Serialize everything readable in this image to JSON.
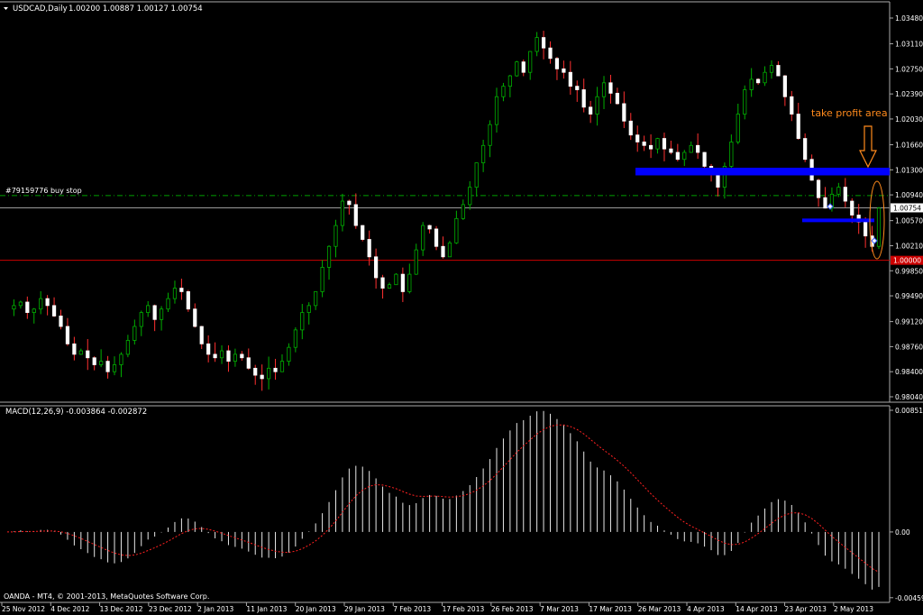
{
  "header": {
    "symbol": "USDCAD,Daily",
    "ohlc": "1.00200 1.00887 1.00127 1.00754"
  },
  "macd_header": {
    "label": "MACD(12,26,9) -0.003864 -0.002872"
  },
  "footer": {
    "copyright": "OANDA - MT4, © 2001-2013, MetaQuotes Software Corp."
  },
  "annotations": {
    "order_label": "#79159776 buy stop",
    "take_profit": "take profit area",
    "current_price": "1.00754",
    "level_label": "1.00000"
  },
  "colors": {
    "background": "#000000",
    "bull_candle": "#00b000",
    "bear_candle": "#ffffff",
    "zone": "#0000ff",
    "annotation": "#ff8a1c",
    "support_line": "#ff0000",
    "order_line": "#00a000",
    "signal_line": "#ff0000"
  },
  "chart_data": [
    {
      "type": "candlestick",
      "title": "USDCAD,Daily",
      "ylim": [
        0.9795,
        1.0355
      ],
      "y_ticks": [
        "1.03480",
        "1.03110",
        "1.02750",
        "1.02390",
        "1.02030",
        "1.01660",
        "1.01300",
        "1.00940",
        "1.00570",
        "1.00210",
        "0.99850",
        "0.99490",
        "0.99120",
        "0.98760",
        "0.98400",
        "0.98040"
      ],
      "y_tick_values": [
        1.0348,
        1.0311,
        1.0275,
        1.0239,
        1.0203,
        1.0166,
        1.013,
        1.0094,
        1.0057,
        1.0021,
        0.9985,
        0.9949,
        0.9912,
        0.9876,
        0.984,
        0.9804
      ],
      "x_ticks": [
        "25 Nov 2012",
        "4 Dec 2012",
        "13 Dec 2012",
        "23 Dec 2012",
        "2 Jan 2013",
        "11 Jan 2013",
        "20 Jan 2013",
        "29 Jan 2013",
        "7 Feb 2013",
        "17 Feb 2013",
        "26 Feb 2013",
        "7 Mar 2013",
        "17 Mar 2013",
        "26 Mar 2013",
        "4 Apr 2013",
        "14 Apr 2013",
        "23 Apr 2013",
        "2 May 2013"
      ],
      "close_path": [
        0.993,
        0.9935,
        0.994,
        0.9925,
        0.993,
        0.9945,
        0.9935,
        0.992,
        0.9905,
        0.988,
        0.9865,
        0.987,
        0.986,
        0.985,
        0.9855,
        0.984,
        0.985,
        0.9865,
        0.9885,
        0.9905,
        0.9925,
        0.9935,
        0.9915,
        0.993,
        0.9945,
        0.996,
        0.9955,
        0.993,
        0.9905,
        0.988,
        0.9865,
        0.986,
        0.987,
        0.9855,
        0.9865,
        0.986,
        0.9845,
        0.9835,
        0.983,
        0.9845,
        0.984,
        0.9855,
        0.9875,
        0.99,
        0.9925,
        0.9935,
        0.9955,
        0.999,
        1.002,
        1.005,
        1.0085,
        1.008,
        1.005,
        1.003,
        1.0005,
        0.9975,
        0.996,
        0.9965,
        0.998,
        0.9955,
        0.998,
        1.0015,
        1.005,
        1.0045,
        1.002,
        1.0005,
        1.0025,
        1.006,
        1.008,
        1.0105,
        1.014,
        1.0165,
        1.0195,
        1.0235,
        1.025,
        1.0265,
        1.0285,
        1.027,
        1.03,
        1.032,
        1.0305,
        1.029,
        1.0275,
        1.027,
        1.025,
        1.0245,
        1.022,
        1.021,
        1.0235,
        1.0255,
        1.024,
        1.0225,
        1.02,
        1.018,
        1.017,
        1.0165,
        1.016,
        1.0175,
        1.016,
        1.0155,
        1.0145,
        1.0155,
        1.0165,
        1.0155,
        1.0135,
        1.0125,
        1.0105,
        1.0135,
        1.017,
        1.021,
        1.0245,
        1.026,
        1.0255,
        1.027,
        1.028,
        1.0265,
        1.0235,
        1.021,
        1.0175,
        1.0145,
        1.0115,
        1.009,
        1.0075,
        1.0095,
        1.0105,
        1.0085,
        1.0065,
        1.0055,
        1.0035,
        1.002,
        1.0075
      ],
      "horizontal_levels": [
        {
          "label": "#79159776 buy stop",
          "value": 1.0093
        },
        {
          "label": "1.00754",
          "value": 1.00754
        },
        {
          "label": "1.00000",
          "value": 1.0
        }
      ],
      "zones": [
        {
          "name": "take profit area",
          "from": 1.0122,
          "to": 1.0133
        },
        {
          "name": "",
          "from": 1.0056,
          "to": 1.006
        }
      ]
    },
    {
      "type": "bar",
      "title": "MACD(12,26,9) -0.003864 -0.002872",
      "ylim": [
        -0.0048,
        0.0087
      ],
      "y_ticks": [
        "0.008512",
        "0.00",
        "-0.004599"
      ],
      "y_tick_values": [
        0.008512,
        0.0,
        -0.004599
      ],
      "macd_value": -0.003864,
      "signal_value": -0.002872
    }
  ]
}
